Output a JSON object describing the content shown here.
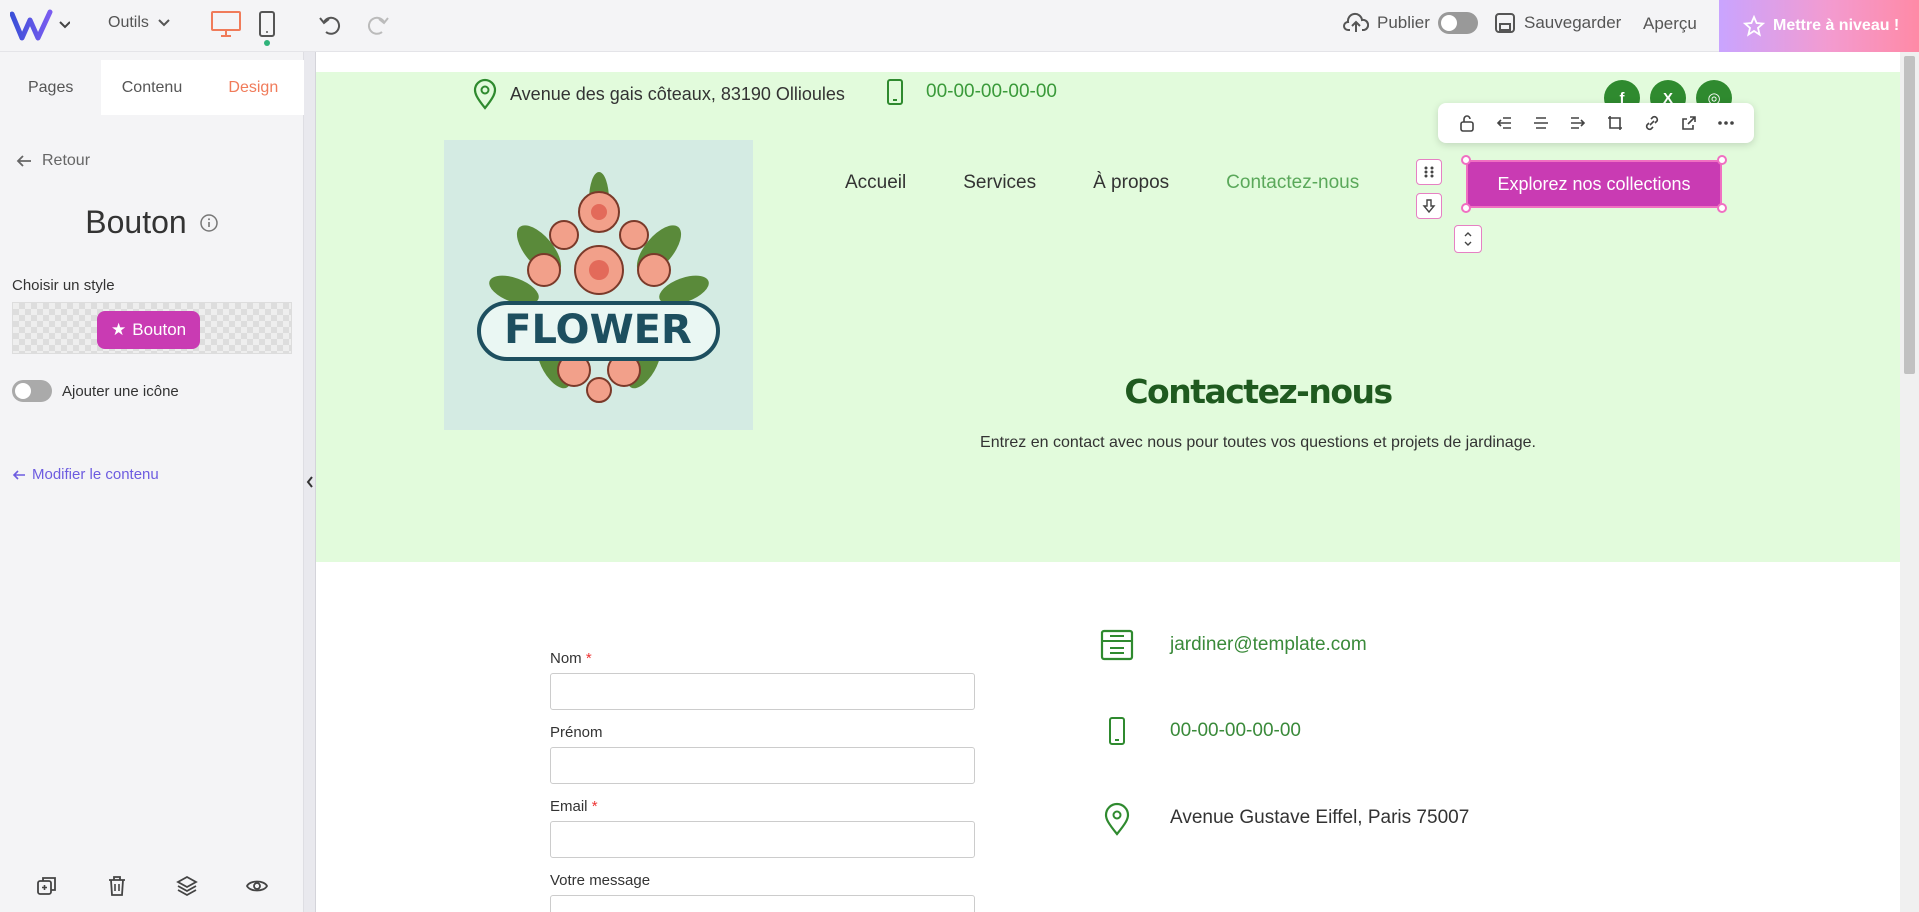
{
  "topbar": {
    "tools_label": "Outils",
    "publish_label": "Publier",
    "save_label": "Sauvegarder",
    "preview_label": "Aperçu",
    "upgrade_label": "Mettre à niveau !"
  },
  "panel": {
    "tabs": [
      {
        "label": "Pages"
      },
      {
        "label": "Contenu"
      },
      {
        "label": "Design"
      }
    ],
    "back_label": "Retour",
    "title": "Bouton",
    "style_label": "Choisir un style",
    "style_button_label": "Bouton",
    "icon_toggle_label": "Ajouter une icône",
    "edit_content_label": "Modifier le contenu"
  },
  "site": {
    "address_top": "Avenue des gais côteaux, 83190 Ollioules",
    "phone_top": "00-00-00-00-00",
    "socials": [
      "f",
      "X",
      "◎"
    ],
    "logo_text": "FLOWER",
    "nav": [
      {
        "label": "Accueil"
      },
      {
        "label": "Services"
      },
      {
        "label": "À propos"
      },
      {
        "label": "Contactez-nous"
      }
    ],
    "cta_label": "Explorez nos collections",
    "hero_title": "Contactez-nous",
    "hero_subtitle": "Entrez en contact avec nous pour toutes vos questions et projets de jardinage.",
    "form": {
      "name_label": "Nom",
      "firstname_label": "Prénom",
      "email_label": "Email",
      "message_label": "Votre message",
      "required_mark": "*"
    },
    "contact": {
      "email": "jardiner@template.com",
      "phone": "00-00-00-00-00",
      "address": "Avenue Gustave Eiffel, Paris 75007"
    }
  },
  "colors": {
    "accent": "#c93bb3",
    "green_bg": "#e2fbdc",
    "green_text": "#3a9a3a",
    "tab_active": "#f07b5a"
  }
}
